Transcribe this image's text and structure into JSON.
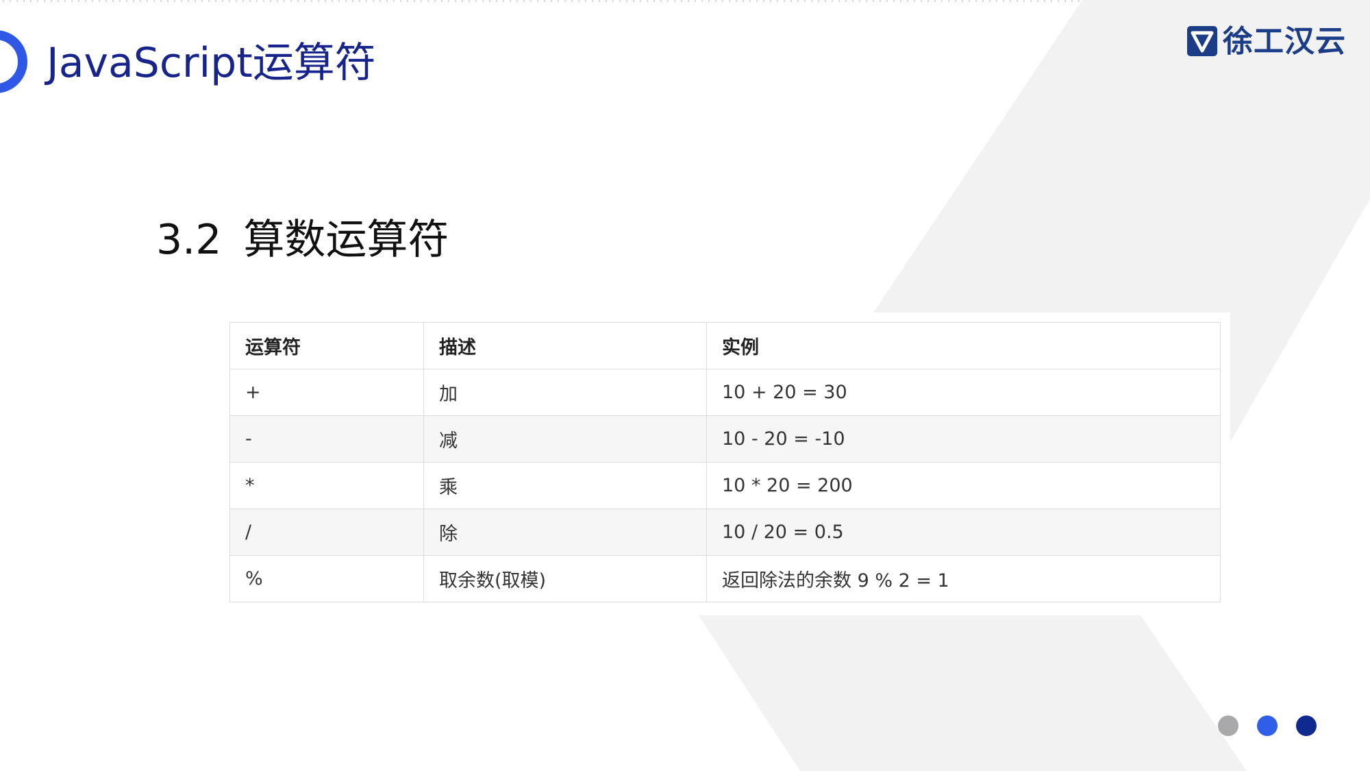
{
  "header": {
    "title": "JavaScript运算符",
    "logo_text": "徐工汉云",
    "accent_color": "#2f58e6",
    "title_color": "#16248c"
  },
  "section": {
    "number": "3.2",
    "title": "算数运算符"
  },
  "table": {
    "headers": [
      "运算符",
      "描述",
      "实例"
    ],
    "rows": [
      [
        "+",
        "加",
        "10 + 20 = 30"
      ],
      [
        "-",
        "减",
        "10 - 20 = -10"
      ],
      [
        "*",
        "乘",
        "10 * 20 = 200"
      ],
      [
        "/",
        "除",
        "10 / 20 = 0.5"
      ],
      [
        "%",
        "取余数(取模)",
        "返回除法的余数 9 % 2 = 1"
      ]
    ]
  },
  "pagination": {
    "dots": [
      {
        "color": "#a9a9ab"
      },
      {
        "color": "#2f5ee8"
      },
      {
        "color": "#0e2a8f"
      }
    ]
  }
}
